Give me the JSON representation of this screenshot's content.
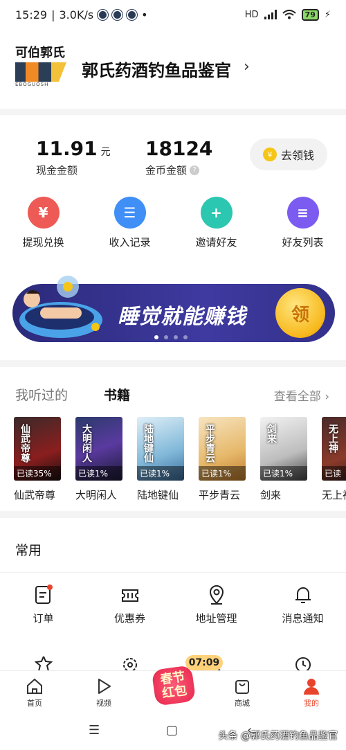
{
  "status_bar": {
    "time": "15:29",
    "speed": "3.0K/s",
    "hd": "HD",
    "battery": "79"
  },
  "profile": {
    "logo_text": "可伯郭氏",
    "logo_sub": "EBOGUOSH",
    "name": "郭氏药酒钓鱼品鉴官"
  },
  "wallet": {
    "cash_value": "11.91",
    "cash_unit": "元",
    "cash_label": "现金金额",
    "coin_value": "18124",
    "coin_label": "金币金额",
    "coin_help": "?",
    "collect_button": "去领钱",
    "collect_icon_char": "¥"
  },
  "actions": [
    {
      "label": "提现兑换",
      "icon": "withdraw-icon",
      "color": "#ee5a55",
      "glyph": "¥"
    },
    {
      "label": "收入记录",
      "icon": "income-record-icon",
      "color": "#3f8ff7",
      "glyph": "☰"
    },
    {
      "label": "邀请好友",
      "icon": "invite-friend-icon",
      "color": "#2cc7b0",
      "glyph": "+"
    },
    {
      "label": "好友列表",
      "icon": "friend-list-icon",
      "color": "#7c5cf0",
      "glyph": "≡"
    }
  ],
  "banner": {
    "slogan": "睡觉就能赚钱",
    "coin_text": "领"
  },
  "books": {
    "tab_history": "我听过的",
    "tab_books": "书籍",
    "see_all": "查看全部 ›",
    "items": [
      {
        "title": "仙武帝尊",
        "cover_text": "仙武帝尊",
        "read": "已读35%",
        "bg": "linear-gradient(160deg,#3a2a2a,#8b1e1e 60%,#1a1010)"
      },
      {
        "title": "大明闲人",
        "cover_text": "大明闲人",
        "read": "已读1%",
        "bg": "linear-gradient(160deg,#2b3a6a,#5a3aa0 50%,#1b1a33)"
      },
      {
        "title": "陆地键仙",
        "cover_text": "陆地键仙",
        "read": "已读1%",
        "bg": "linear-gradient(160deg,#dfeff8,#7fb7d8 60%,#3a6a9a)"
      },
      {
        "title": "平步青云",
        "cover_text": "平步青云",
        "read": "已读1%",
        "bg": "linear-gradient(160deg,#f7e4c0,#e6b86a 60%,#c07b2a)"
      },
      {
        "title": "剑来",
        "cover_text": "剑来",
        "read": "已读1%",
        "bg": "linear-gradient(160deg,#f2f2f2,#bdbdbd 60%,#444)"
      },
      {
        "title": "无上神",
        "cover_text": "无上神",
        "read": "已读",
        "bg": "linear-gradient(160deg,#4a2a2a,#8a3a2a 60%,#2a1a1a)"
      }
    ]
  },
  "common": {
    "title": "常用",
    "row1": [
      {
        "label": "订单",
        "icon": "order-icon"
      },
      {
        "label": "优惠券",
        "icon": "coupon-icon"
      },
      {
        "label": "地址管理",
        "icon": "address-icon"
      },
      {
        "label": "消息通知",
        "icon": "notification-bell-icon"
      }
    ],
    "row2": [
      {
        "icon": "favorite-star-icon"
      },
      {
        "icon": "settings-gear-icon"
      },
      {
        "icon": "more-icon"
      },
      {
        "icon": "history-clock-icon"
      }
    ]
  },
  "festival": {
    "timer": "07:09",
    "text_line1": "春节",
    "text_line2": "红包"
  },
  "tabs": [
    {
      "label": "首页",
      "icon": "home-icon",
      "active": false
    },
    {
      "label": "视频",
      "icon": "video-play-icon",
      "active": false
    },
    {
      "label": "",
      "icon": "festival-icon",
      "active": false
    },
    {
      "label": "商城",
      "icon": "shop-bag-icon",
      "active": false
    },
    {
      "label": "我的",
      "icon": "profile-icon",
      "active": true
    }
  ],
  "watermark": "头条 @郭氏药酒钓鱼品鉴官",
  "colors": {
    "accent": "#e8432b",
    "banner": "#3e3aa0"
  }
}
